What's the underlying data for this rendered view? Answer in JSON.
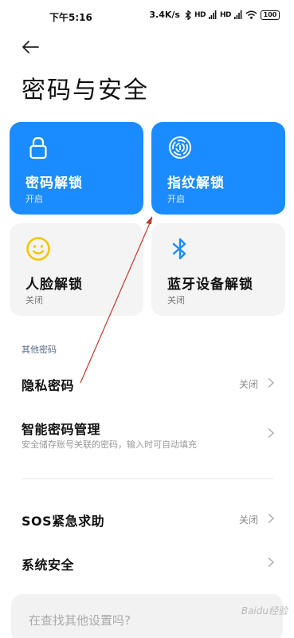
{
  "status_bar": {
    "time": "下午5:16",
    "speed": "3.4K/s",
    "signal1": "HD",
    "signal2": "HD",
    "battery": "100"
  },
  "page": {
    "title": "密码与安全"
  },
  "unlock_cards": [
    {
      "name": "密码解锁",
      "state": "开启",
      "icon": "lock-icon",
      "active": true
    },
    {
      "name": "指纹解锁",
      "state": "开启",
      "icon": "fingerprint-icon",
      "active": true
    },
    {
      "name": "人脸解锁",
      "state": "关闭",
      "icon": "smiley-face-icon",
      "active": false
    },
    {
      "name": "蓝牙设备解锁",
      "state": "关闭",
      "icon": "bluetooth-icon",
      "active": false
    }
  ],
  "other_passwords": {
    "section_label": "其他密码",
    "items": [
      {
        "title": "隐私密码",
        "value": "关闭"
      },
      {
        "title": "智能密码管理",
        "subtitle": "安全储存账号关联的密码，输入时可自动填充"
      }
    ]
  },
  "more_items": [
    {
      "title": "SOS紧急求助",
      "value": "关闭"
    },
    {
      "title": "系统安全"
    }
  ],
  "search": {
    "placeholder": "在查找其他设置吗?"
  },
  "colors": {
    "active_card": "#1a8cff",
    "inactive_card": "#f4f4f4",
    "face_icon": "#f5c400",
    "bluetooth_icon": "#1a8cff",
    "annotation_arrow": "#c0392b"
  }
}
